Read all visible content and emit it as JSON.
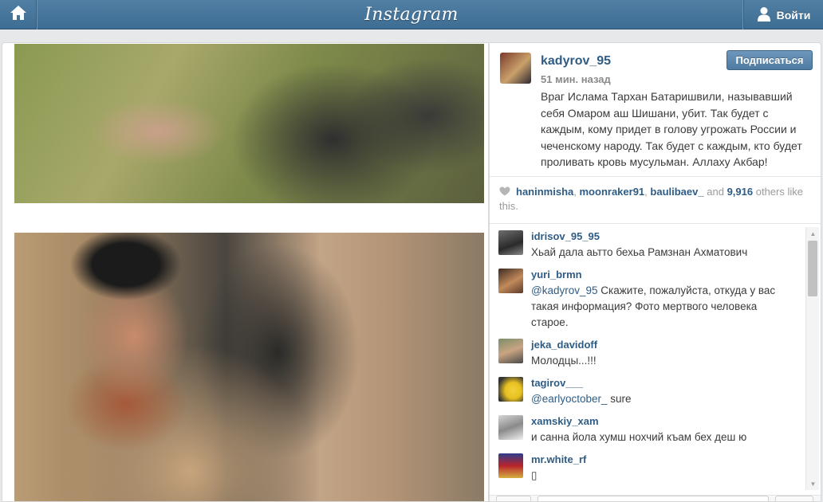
{
  "header": {
    "brand": "Instagram",
    "login_label": "Войти",
    "colors": {
      "bar": "#517fa4",
      "link": "#2f5c85"
    }
  },
  "post": {
    "username": "kadyrov_95",
    "time": "51 мин. назад",
    "follow_label": "Подписаться",
    "caption": "Враг Ислама Тархан Батаришвили, называвший себя Омаром аш Шишани, убит. Так будет с каждым, кому придет в голову угрожать России и чеченскому народу. Так будет с каждым, кто будет проливать кровь мусульман. Аллаху Акбар!"
  },
  "likes": {
    "user1": "haninmisha",
    "sep1": ",",
    "user2": "moonraker91",
    "sep2": ",",
    "user3": "baulibaev_",
    "and_label": "and",
    "count": "9,916",
    "suffix": "others like this."
  },
  "comments": [
    {
      "user": "idrisov_95_95",
      "mention": "",
      "text": "Хьай дала аьтто бехьа Рамзнан Ахматович"
    },
    {
      "user": "yuri_brmn",
      "mention": "@kadyrov_95",
      "text": "Скажите, пожалуйста, откуда у вас такая информация? Фото мертвого человека старое."
    },
    {
      "user": "jeka_davidoff",
      "mention": "",
      "text": "Молодцы...!!!"
    },
    {
      "user": "tagirov___",
      "mention": "@earlyoctober_",
      "text": "sure"
    },
    {
      "user": "xamskiy_xam",
      "mention": "",
      "text": "и санна йола хумш нохчий къам бех деш ю"
    },
    {
      "user": "mr.white_rf",
      "mention": "",
      "text": "▯"
    }
  ],
  "icons": {
    "home": "home-icon",
    "user": "user-icon",
    "heart": "heart-icon"
  }
}
